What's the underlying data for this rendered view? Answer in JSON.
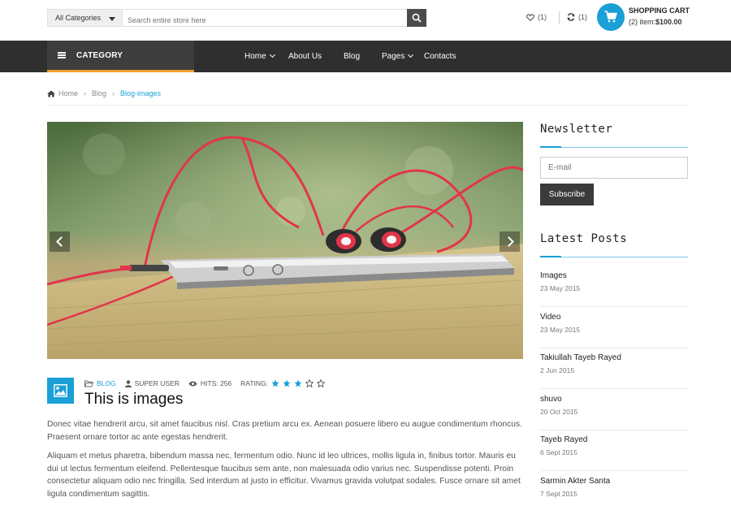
{
  "header": {
    "category_select": "All Categories",
    "search_placeholder": "Search entire store here",
    "wishlist_count": "(1)",
    "compare_count": "(1)",
    "cart_title": "SHOPPING CART",
    "cart_items": "(2) item:",
    "cart_total": "$100.00"
  },
  "nav": {
    "category_label": "CATEGORY",
    "items": [
      {
        "label": "Home",
        "has_dropdown": true
      },
      {
        "label": "About Us",
        "has_dropdown": false
      },
      {
        "label": "Blog",
        "has_dropdown": false
      },
      {
        "label": "Pages",
        "has_dropdown": true
      },
      {
        "label": "Contacts",
        "has_dropdown": false
      }
    ]
  },
  "breadcrumb": [
    "Home",
    "Blog",
    "Blog-images"
  ],
  "post": {
    "category": "BLOG",
    "author": "SUPER USER",
    "hits": "HITS: 256",
    "rating_label": "RATING:",
    "rating": 3,
    "rating_max": 5,
    "title": "This is images",
    "paragraphs": [
      "Donec vitae hendrerit arcu, sit amet faucibus nisl. Cras pretium arcu ex. Aenean posuere libero eu augue condimentum rhoncus. Praesent ornare tortor ac ante egestas hendrerit.",
      "Aliquam et metus pharetra, bibendum massa nec, fermentum odio. Nunc id leo ultrices, mollis ligula in, finibus tortor. Mauris eu dui ut lectus fermentum eleifend. Pellentesque faucibus sem ante, non malesuada odio varius nec. Suspendisse potenti. Proin consectetur aliquam odio nec fringilla. Sed interdum at justo in efficitur. Vivamus gravida volutpat sodales. Fusce ornare sit amet ligula condimentum sagittis."
    ]
  },
  "sidebar": {
    "newsletter_title": "Newsletter",
    "email_placeholder": "E-mail",
    "subscribe_label": "Subscribe",
    "latest_title": "Latest Posts",
    "latest_posts": [
      {
        "title": "Images",
        "date": "23 May 2015"
      },
      {
        "title": "Video",
        "date": "23 May 2015"
      },
      {
        "title": "Takiullah Tayeb Rayed",
        "date": "2 Jun 2015"
      },
      {
        "title": "shuvo",
        "date": "20 Oct 2015"
      },
      {
        "title": "Tayeb Rayed",
        "date": "6 Sept 2015"
      },
      {
        "title": "Sarmin Akter Santa",
        "date": "7 Sept 2015"
      }
    ]
  },
  "colors": {
    "accent": "#1a9fd6",
    "nav_bg": "#2f2f2f",
    "category_underline": "#f0a030"
  }
}
